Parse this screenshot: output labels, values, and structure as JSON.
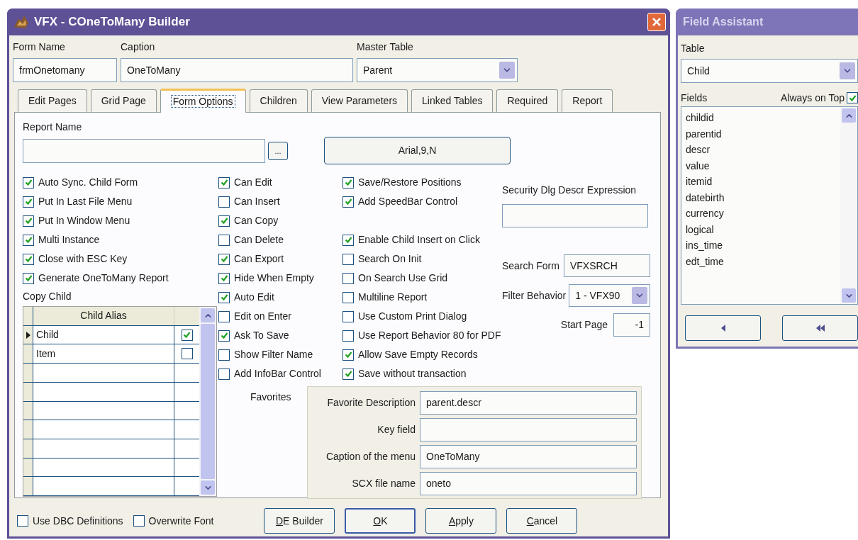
{
  "window": {
    "title": "VFX - COneToMany Builder"
  },
  "header": {
    "form_name": {
      "label": "Form Name",
      "value": "frmOnetomany"
    },
    "caption": {
      "label": "Caption",
      "value": "OneToMany"
    },
    "master_table": {
      "label": "Master Table",
      "value": "Parent"
    }
  },
  "tabs": [
    {
      "label": "Edit Pages",
      "selected": false
    },
    {
      "label": "Grid Page",
      "selected": false
    },
    {
      "label": "Form Options",
      "selected": true
    },
    {
      "label": "Children",
      "selected": false
    },
    {
      "label": "View Parameters",
      "selected": false
    },
    {
      "label": "Linked Tables",
      "selected": false
    },
    {
      "label": "Required",
      "selected": false
    },
    {
      "label": "Report",
      "selected": false
    }
  ],
  "report_name": {
    "label": "Report Name",
    "browse": "..."
  },
  "font_button": "Arial,9,N",
  "options_col1": [
    {
      "label": "Auto Sync. Child Form",
      "checked": true
    },
    {
      "label": "Put In Last File Menu",
      "checked": true
    },
    {
      "label": "Put In Window Menu",
      "checked": true
    },
    {
      "label": "Multi Instance",
      "checked": true
    },
    {
      "label": "Close with ESC Key",
      "checked": true
    },
    {
      "label": "Generate OneToMany Report",
      "checked": true
    }
  ],
  "copy_child": {
    "label": "Copy Child",
    "column": "Child Alias",
    "rows": [
      {
        "alias": "Child",
        "checked": true,
        "current": true
      },
      {
        "alias": "Item",
        "checked": false,
        "current": false
      }
    ]
  },
  "options_col2": [
    {
      "label": "Can Edit",
      "checked": true
    },
    {
      "label": "Can Insert",
      "checked": false
    },
    {
      "label": "Can Copy",
      "checked": true
    },
    {
      "label": "Can Delete",
      "checked": false
    },
    {
      "label": "Can Export",
      "checked": true
    },
    {
      "label": "Hide When Empty",
      "checked": true
    },
    {
      "label": "Auto Edit",
      "checked": true
    },
    {
      "label": "Edit on Enter",
      "checked": false
    },
    {
      "label": "Ask To Save",
      "checked": true
    },
    {
      "label": "Show Filter Name",
      "checked": false
    },
    {
      "label": "Add InfoBar Control",
      "checked": false
    }
  ],
  "options_col3_top": [
    {
      "label": "Save/Restore Positions",
      "checked": true
    },
    {
      "label": "Add SpeedBar Control",
      "checked": true
    }
  ],
  "options_col3_bottom": [
    {
      "label": "Enable Child Insert on Click",
      "checked": true
    },
    {
      "label": "Search On Init",
      "checked": false
    },
    {
      "label": "On Search Use Grid",
      "checked": false
    },
    {
      "label": "Multiline Report",
      "checked": false
    },
    {
      "label": "Use Custom Print Dialog",
      "checked": false
    },
    {
      "label": "Use Report Behavior 80 for PDF",
      "checked": false
    },
    {
      "label": "Allow Save Empty Records",
      "checked": true
    },
    {
      "label": "Save without transaction",
      "checked": true
    }
  ],
  "security": {
    "label": "Security Dlg Descr Expression"
  },
  "search_form": {
    "label": "Search Form",
    "value": "VFXSRCH"
  },
  "filter_behavior": {
    "label": "Filter Behavior",
    "value": "1 - VFX90"
  },
  "start_page": {
    "label": "Start Page",
    "value": "-1"
  },
  "favorites": {
    "label": "Favorites",
    "fields": [
      {
        "label": "Favorite Description",
        "value": "parent.descr"
      },
      {
        "label": "Key field"
      },
      {
        "label": "Caption of the menu",
        "value": "OneToMany"
      },
      {
        "label": "SCX file name",
        "value": "oneto"
      }
    ]
  },
  "bottom_options": [
    {
      "label": "Use DBC Definitions",
      "checked": false
    },
    {
      "label": "Overwrite Font",
      "checked": false
    }
  ],
  "buttons": [
    {
      "label": "DE Builder",
      "default": false
    },
    {
      "label": "OK",
      "default": true
    },
    {
      "label": "Apply",
      "default": false
    },
    {
      "label": "Cancel",
      "default": false
    }
  ],
  "field_assistant": {
    "title": "Field Assistant",
    "table": {
      "label": "Table",
      "value": "Child"
    },
    "fields_label": "Fields",
    "always_on_top": {
      "label": "Always on Top",
      "checked": true
    },
    "fields": [
      "childid",
      "parentid",
      "descr",
      "value",
      "itemid",
      "datebirth",
      "currency",
      "logical",
      "ins_time",
      "edt_time"
    ],
    "buttons": [
      {
        "kind": "single"
      },
      {
        "kind": "all"
      }
    ]
  }
}
